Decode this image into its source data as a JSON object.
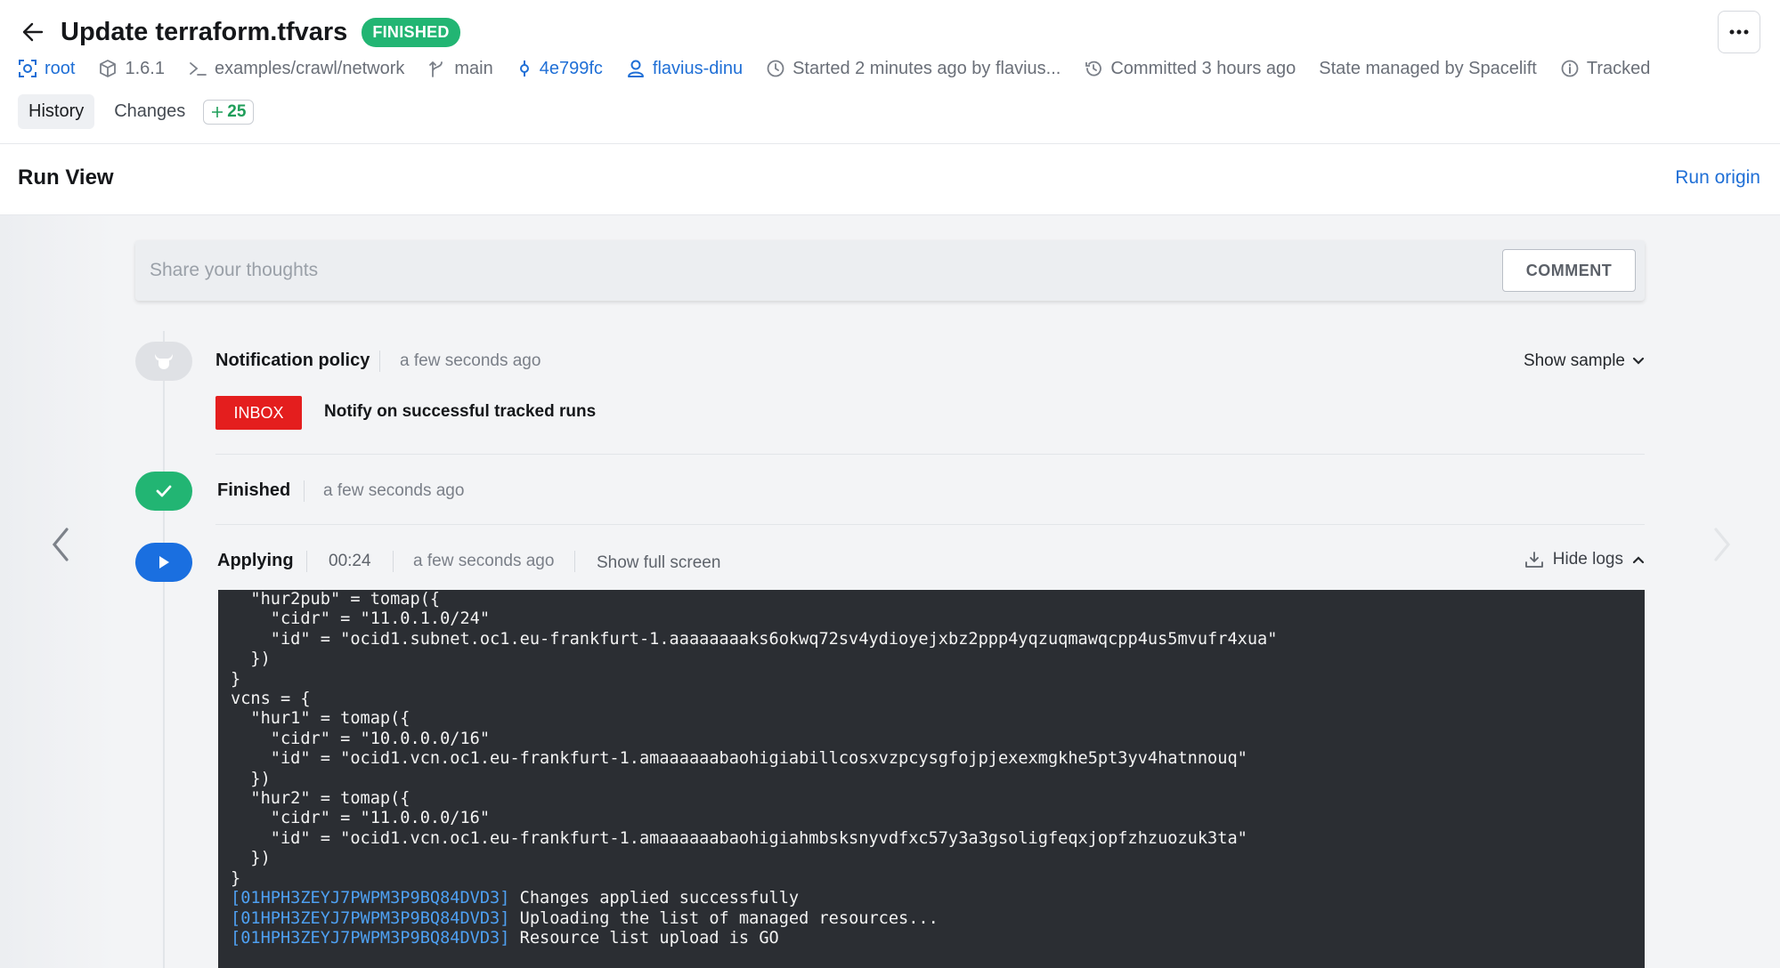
{
  "header": {
    "title": "Update terraform.tfvars",
    "status": "FINISHED",
    "meta": {
      "space": "root",
      "version": "1.6.1",
      "path": "examples/crawl/network",
      "branch": "main",
      "commit": "4e799fc",
      "user": "flavius-dinu",
      "started": "Started 2 minutes ago by flavius...",
      "committed": "Committed 3 hours ago",
      "state": "State managed by Spacelift",
      "tracked": "Tracked"
    },
    "tabs": [
      {
        "label": "History"
      },
      {
        "label": "Changes"
      }
    ],
    "changes_count": "25"
  },
  "runview": {
    "title": "Run View",
    "origin_link": "Run origin"
  },
  "comment": {
    "placeholder": "Share your thoughts",
    "button": "COMMENT"
  },
  "timeline": {
    "notification": {
      "title": "Notification policy",
      "time": "a few seconds ago",
      "show_sample": "Show sample",
      "badge": "INBOX",
      "message": "Notify on successful tracked runs"
    },
    "finished": {
      "title": "Finished",
      "time": "a few seconds ago"
    },
    "applying": {
      "title": "Applying",
      "duration": "00:24",
      "time": "a few seconds ago",
      "full_screen": "Show full screen",
      "hide_logs": "Hide logs"
    }
  },
  "logs": {
    "lines": [
      "  \"hur2pub\" = tomap({",
      "    \"cidr\" = \"11.0.1.0/24\"",
      "    \"id\" = \"ocid1.subnet.oc1.eu-frankfurt-1.aaaaaaaaks6okwq72sv4ydioyejxbz2ppp4yqzuqmawqcpp4us5mvufr4xua\"",
      "  })",
      "}",
      "vcns = {",
      "  \"hur1\" = tomap({",
      "    \"cidr\" = \"10.0.0.0/16\"",
      "    \"id\" = \"ocid1.vcn.oc1.eu-frankfurt-1.amaaaaaabaohigiabillcosxvzpcysgfojpjexexmgkhe5pt3yv4hatnnouq\"",
      "  })",
      "  \"hur2\" = tomap({",
      "    \"cidr\" = \"11.0.0.0/16\"",
      "    \"id\" = \"ocid1.vcn.oc1.eu-frankfurt-1.amaaaaaabaohigiahmbsksnyvdfxc57y3a3gsoligfeqxjopfzhzuozuk3ta\"",
      "  })",
      "}"
    ],
    "run_id": "[01HPH3ZEYJ7PWPM3P9BQ84DVD3]",
    "status_lines": [
      "Changes applied successfully",
      "Uploading the list of managed resources...",
      "Resource list upload is GO"
    ]
  },
  "colors": {
    "finished_badge": "#22b573",
    "link": "#1f6fd6",
    "inbox": "#e41e1e",
    "apply_blue": "#1a6fe0",
    "log_bg": "#2b2e33",
    "log_prefix": "#4ea0f2"
  },
  "icons": {
    "back": "arrow-left-icon",
    "more": "ellipsis-icon",
    "space": "target-icon",
    "version": "cube-icon",
    "path": "terminal-icon",
    "branch": "branch-icon",
    "commit": "commit-icon",
    "user": "user-icon",
    "started": "clock-icon",
    "committed": "history-icon",
    "tracked": "info-icon"
  }
}
